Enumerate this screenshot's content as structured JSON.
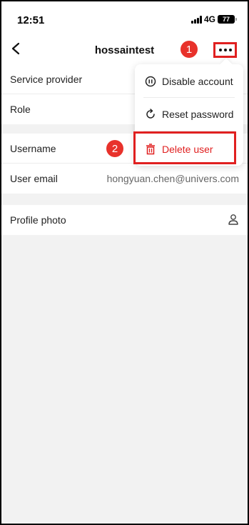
{
  "statusbar": {
    "time": "12:51",
    "network": "4G",
    "battery": "77"
  },
  "navbar": {
    "title": "hossaintest",
    "back_icon": "chevron-left-icon",
    "more_icon": "ellipsis-icon"
  },
  "info_group_1": {
    "items": [
      {
        "label": "Service provider"
      },
      {
        "label": "Role"
      }
    ]
  },
  "info_group_2": {
    "items": [
      {
        "label": "Username"
      },
      {
        "label": "User email",
        "value": "hongyuan.chen@univers.com"
      }
    ]
  },
  "info_group_3": {
    "items": [
      {
        "label": "Profile photo",
        "icon": "person-icon"
      }
    ]
  },
  "menu": {
    "items": [
      {
        "label": "Disable account",
        "icon": "pause-circle-icon"
      },
      {
        "label": "Reset password",
        "icon": "refresh-icon"
      },
      {
        "label": "Delete user",
        "icon": "trash-icon"
      }
    ]
  },
  "annotations": {
    "step1": "1",
    "step2": "2",
    "color": "#e8322b"
  }
}
